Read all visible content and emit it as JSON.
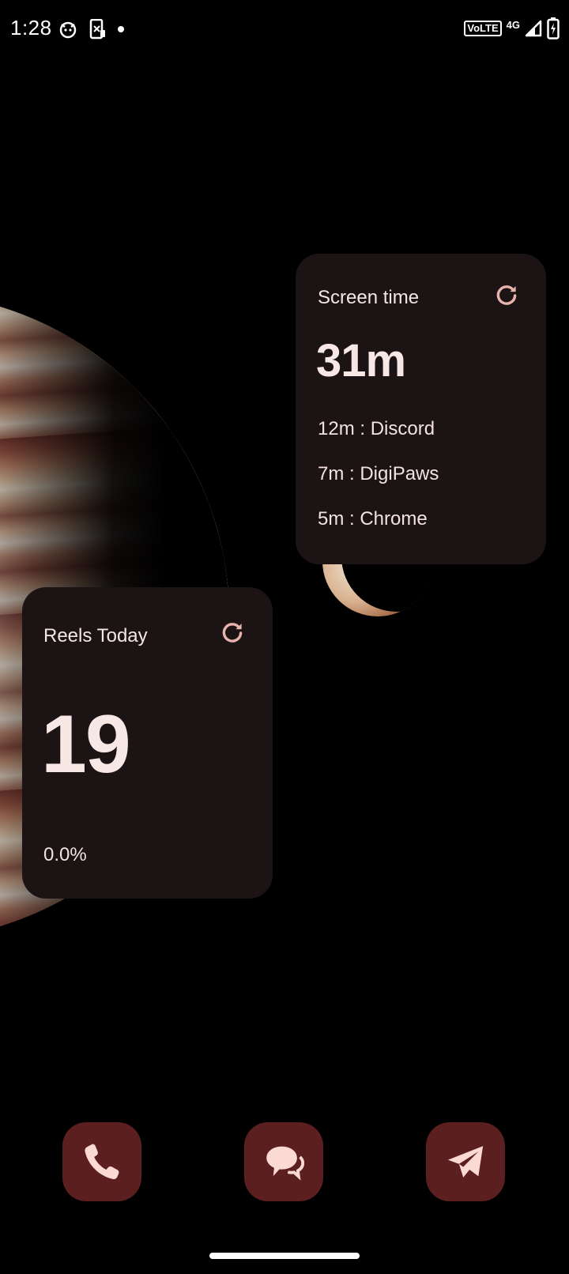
{
  "status_bar": {
    "time": "1:28",
    "left_icons": [
      "cat-face-icon",
      "phone-screen-icon",
      "dot-icon"
    ],
    "volte": "VoLTE",
    "network": "4G",
    "right_icons": [
      "signal-icon",
      "battery-charging-icon"
    ]
  },
  "screen_time_widget": {
    "title": "Screen time",
    "total": "31m",
    "apps": [
      {
        "label": "12m : Discord"
      },
      {
        "label": "7m : DigiPaws"
      },
      {
        "label": "5m : Chrome"
      }
    ],
    "refresh_icon": "refresh-icon"
  },
  "reels_widget": {
    "title": "Reels Today",
    "count": "19",
    "percent": "0.0%",
    "refresh_icon": "refresh-icon"
  },
  "dock": {
    "apps": [
      "phone-icon",
      "messages-icon",
      "telegram-icon"
    ]
  },
  "colors": {
    "widget_bg": "#1c1414",
    "widget_text": "#f3dcd8",
    "icon_accent": "#e9b3ad",
    "dock_bg": "#5c1f1f",
    "dock_glyph": "#fbd9d4"
  }
}
